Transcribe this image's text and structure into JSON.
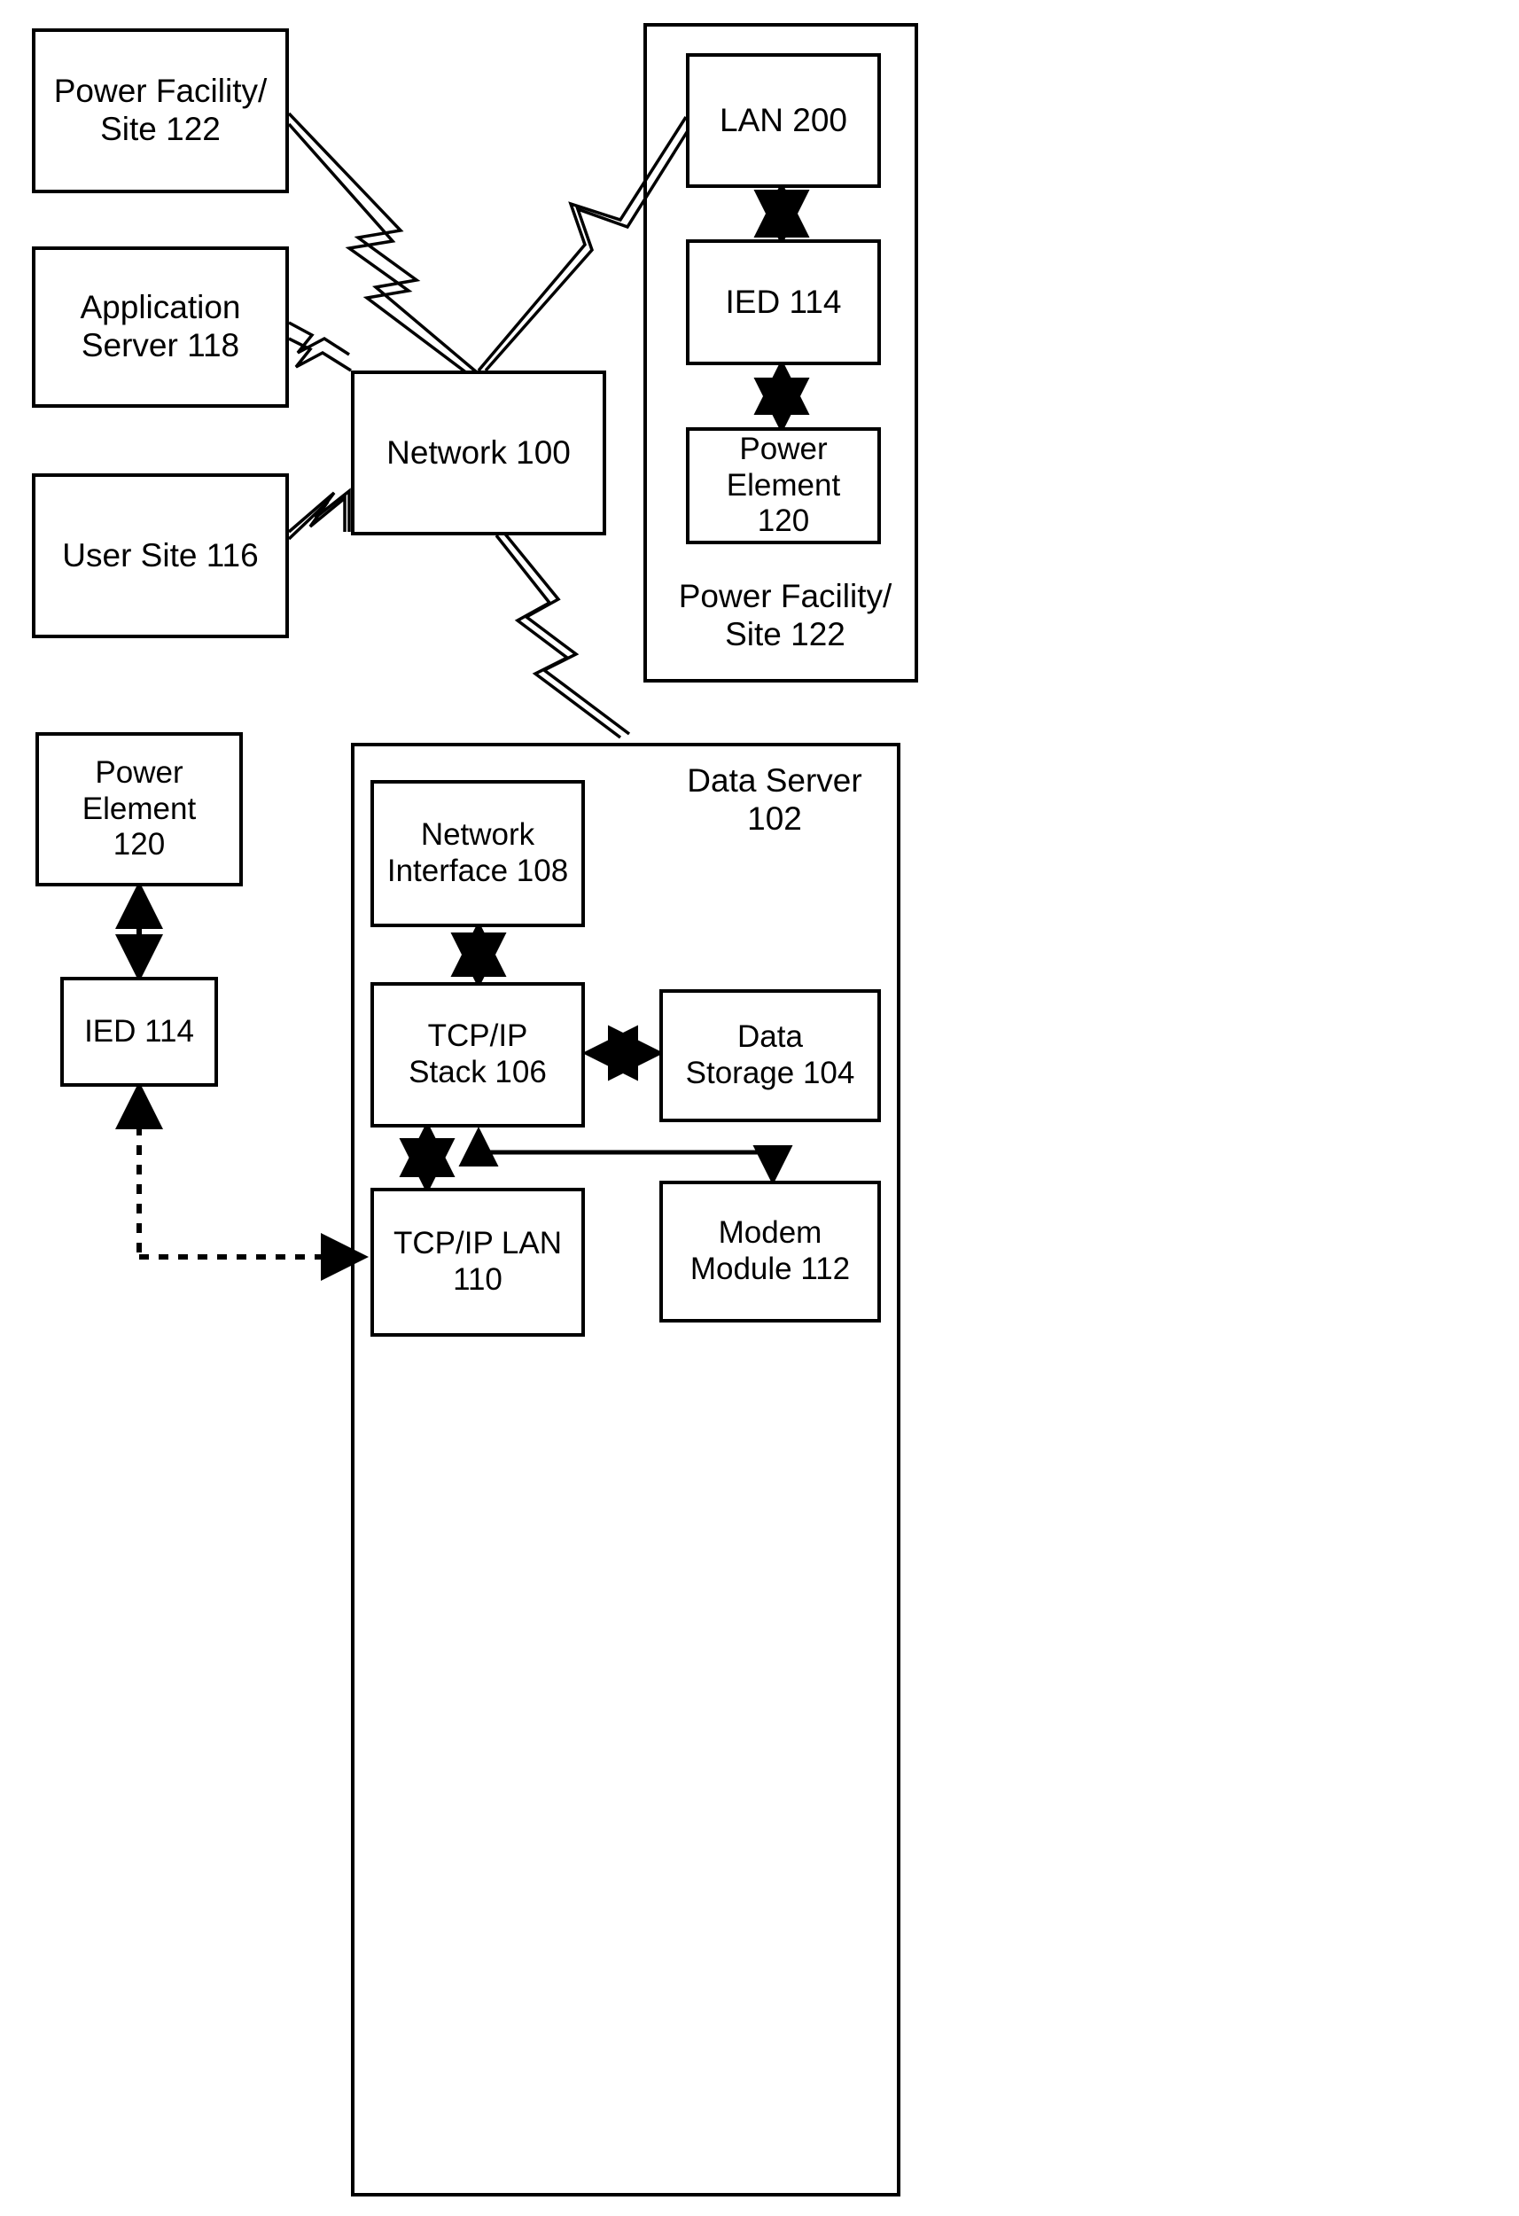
{
  "figure": {
    "type": "patent-block-diagram",
    "background": "#ffffff",
    "line_color": "#000000"
  },
  "nodes": {
    "power_facility_left": {
      "label": "Power Facility/\nSite 122"
    },
    "application_server": {
      "label": "Application\nServer 118"
    },
    "user_site": {
      "label": "User Site 116"
    },
    "network": {
      "label": "Network 100"
    },
    "lan": {
      "label": "LAN 200"
    },
    "ied_right": {
      "label": "IED 114"
    },
    "power_element_right": {
      "label": "Power\nElement\n120"
    },
    "power_facility_caption": {
      "label": "Power Facility/\nSite 122"
    },
    "power_element_left": {
      "label": "Power\nElement\n120"
    },
    "ied_left": {
      "label": "IED 114"
    },
    "data_server_caption": {
      "label": "Data Server\n102"
    },
    "network_interface": {
      "label": "Network\nInterface 108"
    },
    "tcpip_stack": {
      "label": "TCP/IP\nStack 106"
    },
    "data_storage": {
      "label": "Data\nStorage 104"
    },
    "tcpip_lan": {
      "label": "TCP/IP LAN\n110"
    },
    "modem_module": {
      "label": "Modem\nModule 112"
    }
  },
  "connections": [
    {
      "name": "power-facility-to-network",
      "style": "lightning"
    },
    {
      "name": "application-server-to-network",
      "style": "lightning"
    },
    {
      "name": "user-site-to-network",
      "style": "lightning"
    },
    {
      "name": "network-to-lan",
      "style": "lightning"
    },
    {
      "name": "network-to-data-server",
      "style": "lightning"
    },
    {
      "name": "lan-to-ied",
      "style": "double-arrow"
    },
    {
      "name": "ied-to-power-element",
      "style": "double-arrow"
    },
    {
      "name": "power-element-to-ied-left",
      "style": "dashed-double-arrow"
    },
    {
      "name": "ied-left-to-tcpip-lan",
      "style": "dashed-arrow"
    },
    {
      "name": "network-interface-to-tcpip-stack",
      "style": "double-arrow"
    },
    {
      "name": "tcpip-stack-to-data-storage",
      "style": "double-arrow"
    },
    {
      "name": "tcpip-stack-to-tcpip-lan",
      "style": "double-arrow"
    },
    {
      "name": "tcpip-stack-to-modem-module",
      "style": "elbow-arrow"
    }
  ]
}
